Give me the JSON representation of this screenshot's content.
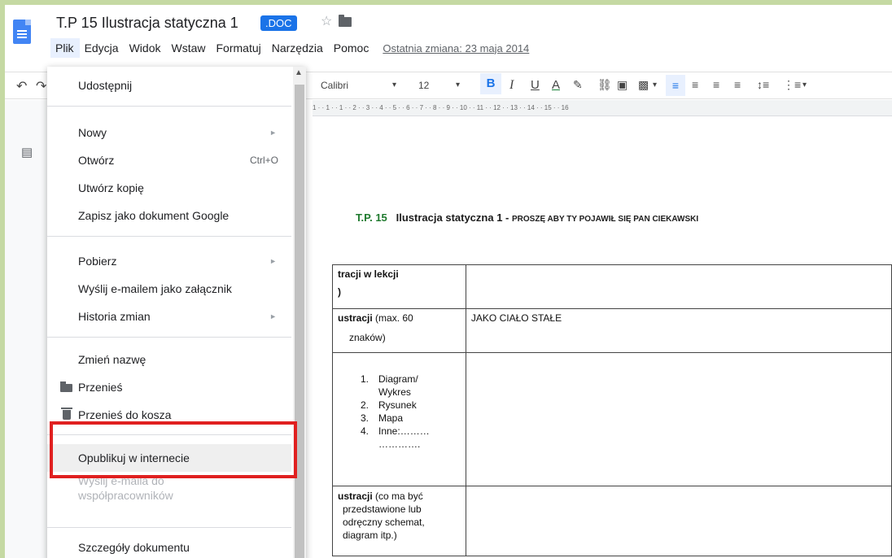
{
  "header": {
    "title": "T.P 15  Ilustracja statyczna 1",
    "badge": ".DOC",
    "star_icon": "☆",
    "last_edit": "Ostatnia zmiana: 23 maja 2014"
  },
  "menubar": [
    "Plik",
    "Edycja",
    "Widok",
    "Wstaw",
    "Formatuj",
    "Narzędzia",
    "Pomoc"
  ],
  "toolbar": {
    "font": "Calibri",
    "size": "12",
    "bold": "B",
    "italic": "I",
    "underline": "U",
    "text_color": "A"
  },
  "ruler": "1 · · 1 · · 1 · · 2 · · 3 · · 4 · · 5 · · 6 · · 7 · · 8 · · 9 · · 10 · · 11 · · 12 · · 13 · · 14 · · 15 · · 16",
  "file_menu": {
    "share": "Udostępnij",
    "new": "Nowy",
    "open": "Otwórz",
    "open_shortcut": "Ctrl+O",
    "copy": "Utwórz kopię",
    "save_google": "Zapisz jako dokument Google",
    "download": "Pobierz",
    "email_attach": "Wyślij e-mailem jako załącznik",
    "history": "Historia zmian",
    "rename": "Zmień nazwę",
    "move": "Przenieś",
    "trash": "Przenieś do kosza",
    "publish": "Opublikuj w internecie",
    "email_collab_1": "Wyślij e-maila do",
    "email_collab_2": "współpracowników",
    "details": "Szczegóły dokumentu"
  },
  "document": {
    "heading_tp": "T.P.  15",
    "heading_title": "Ilustracja statyczna 1  -",
    "heading_sub": "PROSZĘ ABY  TY  POJAWIŁ SIĘ  PAN  CIEKAWSKI",
    "rows": {
      "r1_a": "tracji w lekcji",
      "r1_b": ")",
      "r2_bold": "ustracji",
      "r2_rest": " (max. 60",
      "r2_line2": "znaków)",
      "r2_value": "JAKO CIAŁO  STAŁE",
      "list": [
        "Diagram/",
        "Wykres",
        "Rysunek",
        "Mapa",
        "Inne:………",
        "…………."
      ],
      "list_nums": [
        "1.",
        "2.",
        "3.",
        "4."
      ],
      "r4_bold": "ustracji",
      "r4_rest": " (co ma być",
      "r4_line2": "przedstawione lub",
      "r4_line3": "odręczny schemat,",
      "r4_line4": "diagram itp.)"
    }
  },
  "colors": {
    "accent": "#1a73e8",
    "highlight_box": "#e02020",
    "background": "#c5d9a3"
  }
}
